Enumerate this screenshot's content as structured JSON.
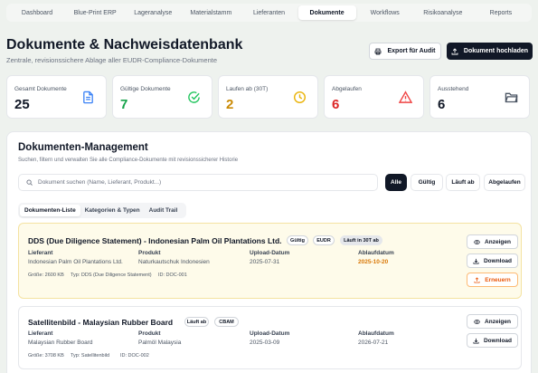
{
  "nav": {
    "tabs": [
      "Dashboard",
      "Blue-Print ERP",
      "Lageranalyse",
      "Materialstamm",
      "Lieferanten",
      "Dokumente",
      "Workflows",
      "Risikoanalyse",
      "Reports"
    ],
    "active": "Dokumente"
  },
  "header": {
    "title": "Dokumente & Nachweisdatenbank",
    "subtitle": "Zentrale, revisionssichere Ablage aller EUDR-Compliance-Dokumente",
    "export_label": "Export für Audit",
    "upload_label": "Dokument hochladen"
  },
  "stats": [
    {
      "label": "Gesamt Dokumente",
      "value": "25",
      "color": "#111827",
      "icon": "document-icon",
      "icon_color": "#3b82f6"
    },
    {
      "label": "Gültige Dokumente",
      "value": "7",
      "color": "#16a34a",
      "icon": "check-circle-icon",
      "icon_color": "#22c55e"
    },
    {
      "label": "Laufen ab (30T)",
      "value": "2",
      "color": "#ca8a04",
      "icon": "clock-icon",
      "icon_color": "#eab308"
    },
    {
      "label": "Abgelaufen",
      "value": "6",
      "color": "#dc2626",
      "icon": "warning-icon",
      "icon_color": "#ef4444"
    },
    {
      "label": "Ausstehend",
      "value": "6",
      "color": "#111827",
      "icon": "folder-icon",
      "icon_color": "#4b5563"
    }
  ],
  "panel": {
    "title": "Dokumenten-Management",
    "subtitle": "Suchen, filtern und verwalten Sie alle Compliance-Dokumente mit revisionssicherer Historie",
    "search_placeholder": "Dokument suchen (Name, Lieferant, Produkt...)",
    "filters": [
      "Alle",
      "Gültig",
      "Läuft ab",
      "Abgelaufen"
    ],
    "active_filter": "Alle",
    "subtabs": [
      "Dokumenten-Liste",
      "Kategorien & Typen",
      "Audit Trail"
    ],
    "active_subtab": "Dokumenten-Liste"
  },
  "labels": {
    "supplier": "Lieferant",
    "product": "Produkt",
    "upload_date": "Upload-Datum",
    "expiry_date": "Ablaufdatum"
  },
  "documents": [
    {
      "title": "DDS (Due Diligence Statement) - Indonesian Palm Oil Plantations Ltd.",
      "badges": [
        "Gültig",
        "EUDR",
        "Läuft in 30T ab"
      ],
      "supplier": "Indonesian Palm Oil Plantations Ltd.",
      "product": "Naturkautschuk Indonesien",
      "upload_date": "2025-07-31",
      "expiry_date": "2025-10-20",
      "size": "Größe: 2600 KB",
      "type": "Typ: DDS (Due Diligence Statement)",
      "id": "ID: DOC-001",
      "actions": [
        "Anzeigen",
        "Download",
        "Erneuern"
      ]
    },
    {
      "title": "Satellitenbild - Malaysian Rubber Board",
      "badges": [
        "Läuft ab",
        "CBAM"
      ],
      "supplier": "Malaysian Rubber Board",
      "product": "Palmöl Malaysia",
      "upload_date": "2025-03-09",
      "expiry_date": "2026-07-21",
      "size": "Größe: 3708 KB",
      "type": "Typ: Satellitenbild",
      "id": "ID: DOC-002",
      "actions": [
        "Anzeigen",
        "Download"
      ]
    }
  ]
}
